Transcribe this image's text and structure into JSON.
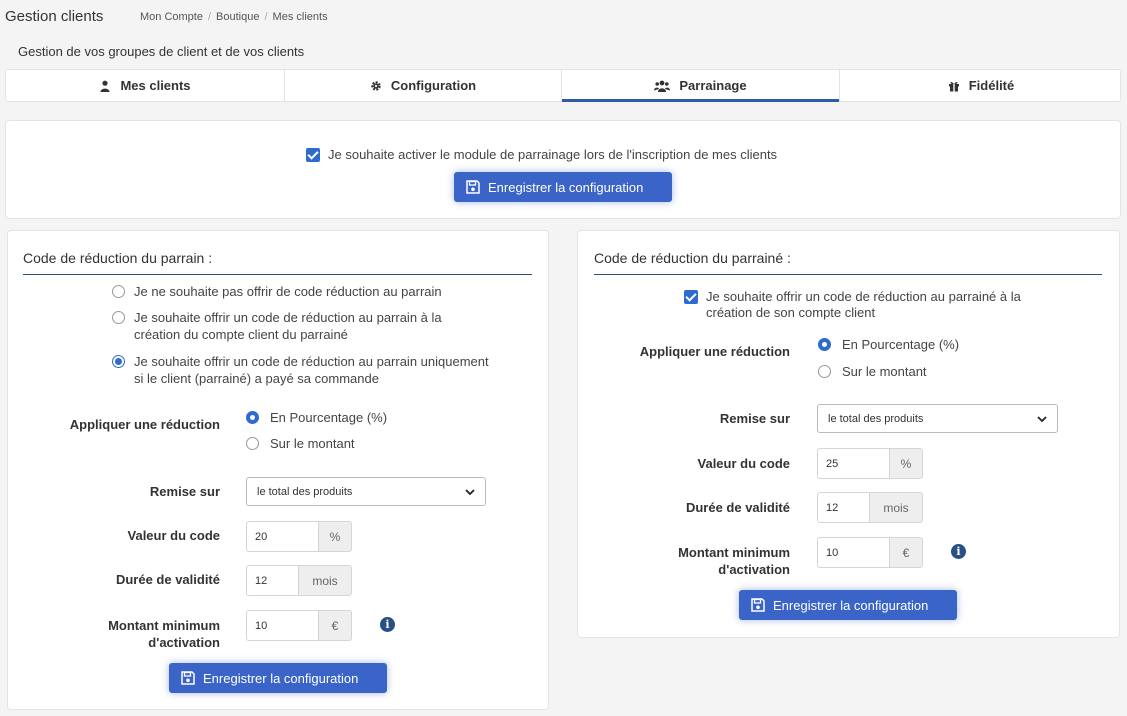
{
  "header": {
    "title": "Gestion clients",
    "breadcrumb": [
      "Mon Compte",
      "Boutique",
      "Mes clients"
    ],
    "subtitle": "Gestion de vos groupes de client et de vos clients"
  },
  "tabs": [
    {
      "label": "Mes clients",
      "icon": "user-icon"
    },
    {
      "label": "Configuration",
      "icon": "gear-icon"
    },
    {
      "label": "Parrainage",
      "icon": "users-icon",
      "active": true
    },
    {
      "label": "Fidélité",
      "icon": "gift-icon"
    }
  ],
  "activation": {
    "checkbox_label": "Je souhaite activer le module de parrainage lors de l'inscription de mes clients",
    "checked": true,
    "save_label": "Enregistrer la configuration"
  },
  "parrain": {
    "heading": "Code de réduction du parrain :",
    "options": [
      "Je ne souhaite pas offrir de code réduction au parrain",
      "Je souhaite offrir un code de réduction au parrain à la création du compte client du parrainé",
      "Je souhaite offrir un code de réduction au parrain uniquement si le client (parrainé) a payé sa commande"
    ],
    "selected_option": 2,
    "apply_label": "Appliquer une réduction",
    "reduction_types": [
      "En Pourcentage (%)",
      "Sur le montant"
    ],
    "remise_label": "Remise sur",
    "remise_value": "le total des produits",
    "valeur_label": "Valeur du code",
    "valeur_value": "20",
    "valeur_unit": "%",
    "duree_label": "Durée de validité",
    "duree_value": "12",
    "duree_unit": "mois",
    "montant_label_1": "Montant minimum",
    "montant_label_2": "d'activation",
    "montant_value": "10",
    "montant_unit": "€",
    "save_label": "Enregistrer la configuration"
  },
  "parraine": {
    "heading": "Code de réduction du parrainé :",
    "checkbox_label": "Je souhaite offrir un code de réduction au parrainé à la création de son compte client",
    "checked": true,
    "apply_label": "Appliquer une réduction",
    "reduction_types": [
      "En Pourcentage (%)",
      "Sur le montant"
    ],
    "remise_label": "Remise sur",
    "remise_value": "le total des produits",
    "valeur_label": "Valeur du code",
    "valeur_value": "25",
    "valeur_unit": "%",
    "duree_label": "Durée de validité",
    "duree_value": "12",
    "duree_unit": "mois",
    "montant_label_1": "Montant minimum",
    "montant_label_2": "d'activation",
    "montant_value": "10",
    "montant_unit": "€",
    "save_label": "Enregistrer la configuration"
  },
  "colors": {
    "accent": "#3a64c8",
    "tab_underline": "#2e5ca8",
    "info_icon": "#2a4e86"
  }
}
